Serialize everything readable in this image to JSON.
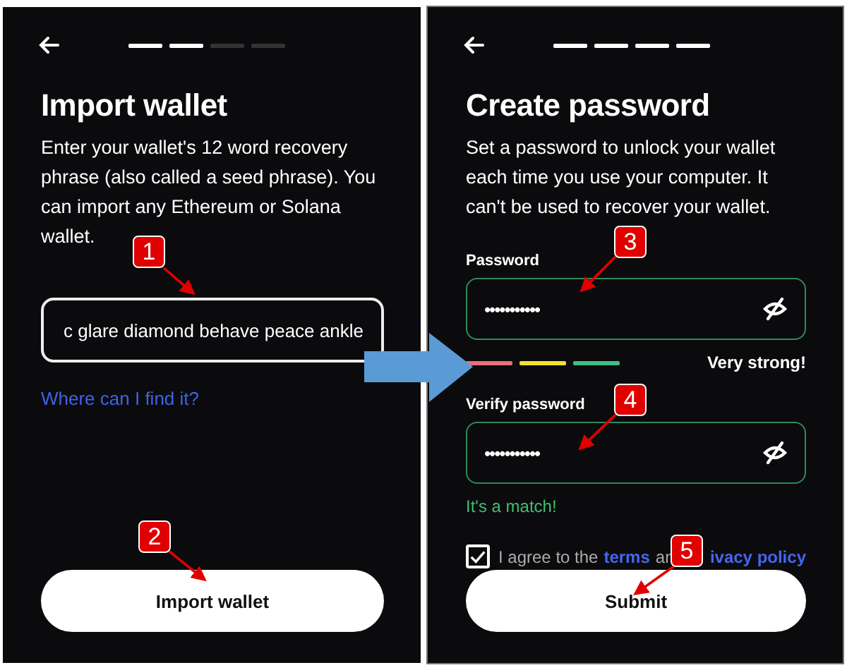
{
  "import_screen": {
    "steps": [
      {
        "on": true
      },
      {
        "on": true
      },
      {
        "on": false
      },
      {
        "on": false
      }
    ],
    "title": "Import wallet",
    "description": "Enter your wallet's 12 word recovery phrase (also called a seed phrase). You can import any Ethereum or Solana wallet.",
    "phrase_field": {
      "value": "c glare diamond behave peace ankle"
    },
    "help_link": "Where can I find it?",
    "button": "Import wallet"
  },
  "password_screen": {
    "steps": [
      {
        "on": true
      },
      {
        "on": true
      },
      {
        "on": true
      },
      {
        "on": true
      }
    ],
    "title": "Create password",
    "description": "Set a password to unlock your wallet each time you use your computer. It can't be used to recover your wallet.",
    "password": {
      "label": "Password",
      "value": "•••••••••••"
    },
    "strength": {
      "segments": [
        {
          "color": "#e8707a"
        },
        {
          "color": "#f2e12e"
        },
        {
          "color": "#3dbf84"
        }
      ],
      "label": "Very strong!"
    },
    "verify": {
      "label": "Verify password",
      "value": "•••••••••••"
    },
    "match_text": "It's a match!",
    "agreement": {
      "checked": true,
      "parts": [
        {
          "kind": "text",
          "text": "I agree to the"
        },
        {
          "kind": "link",
          "text": "terms"
        },
        {
          "kind": "text",
          "text": "an"
        },
        {
          "kind": "gap"
        },
        {
          "kind": "link",
          "text": "ivacy policy"
        }
      ]
    },
    "button": "Submit"
  },
  "annotations": [
    "1",
    "2",
    "3",
    "4",
    "5"
  ]
}
